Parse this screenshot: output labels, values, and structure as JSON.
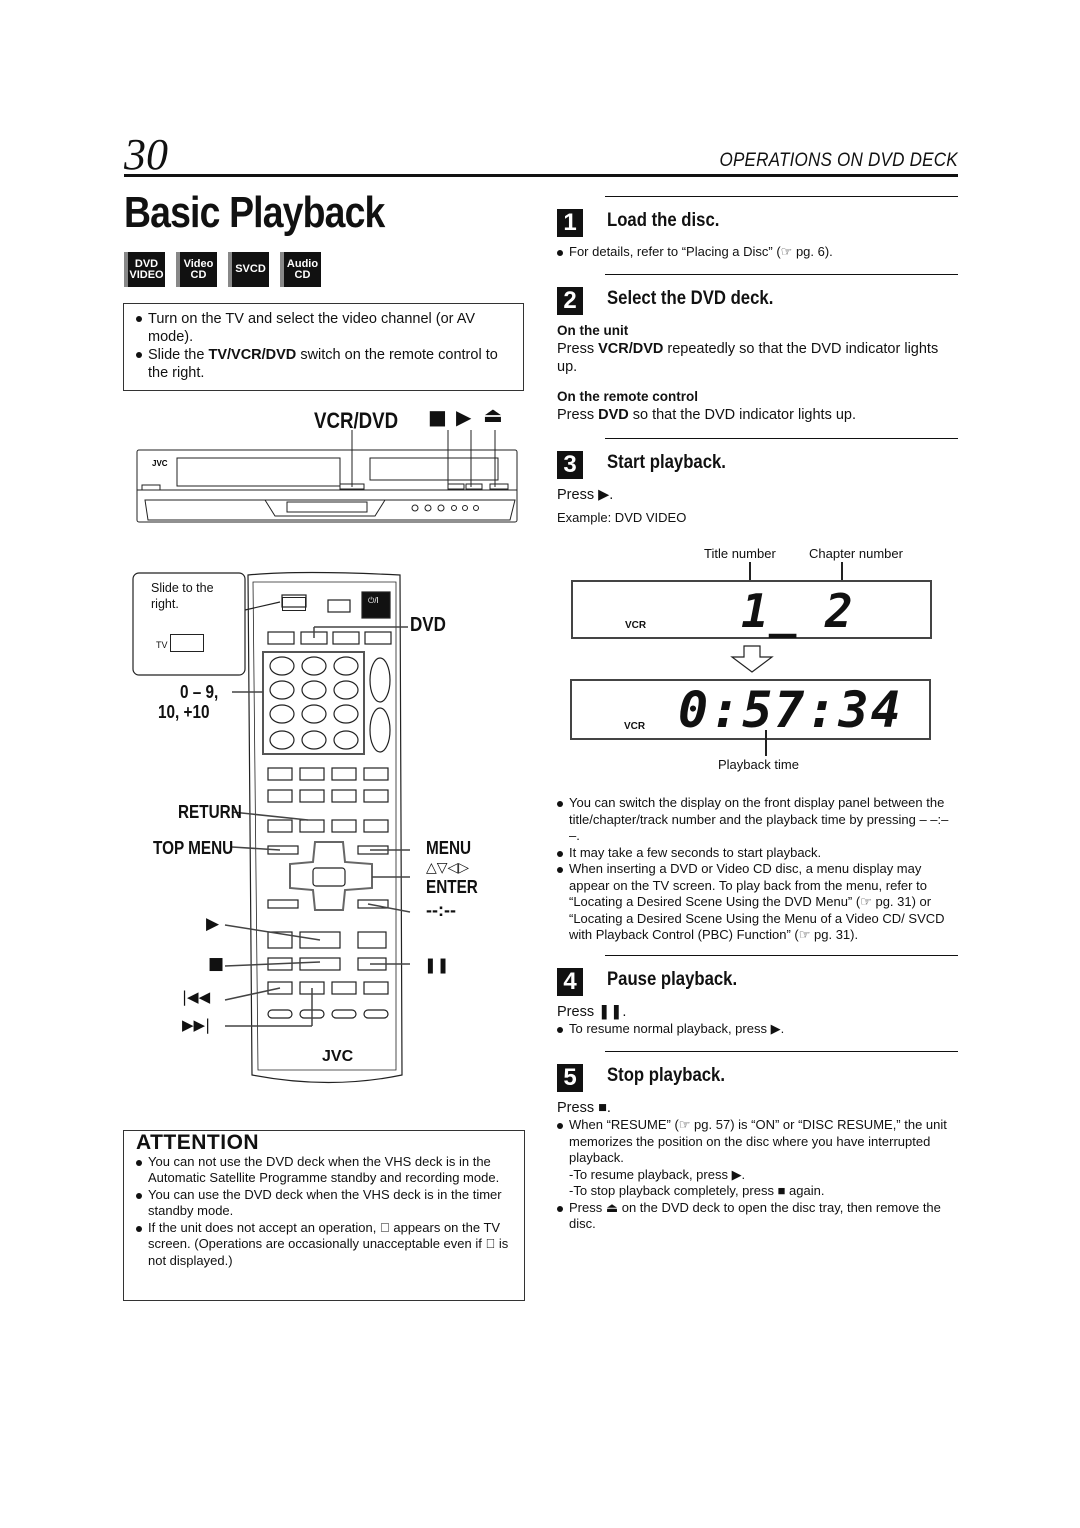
{
  "header": {
    "page_number": "30",
    "section_title": "OPERATIONS ON DVD DECK"
  },
  "title": "Basic Playback",
  "disc_badges": [
    {
      "line1": "DVD",
      "line2": "VIDEO"
    },
    {
      "line1": "Video",
      "line2": "CD"
    },
    {
      "line1": "SVCD",
      "line2": ""
    },
    {
      "line1": "Audio",
      "line2": "CD"
    }
  ],
  "prerequisites": [
    {
      "text": "Turn on the TV and select the video channel (or AV mode)."
    },
    {
      "pre": "Slide the ",
      "bold": "TV/VCR/DVD",
      "post": " switch on the remote control to the right."
    }
  ],
  "deck_diagram": {
    "vcr_dvd_label": "VCR/DVD",
    "stop_symbol": "■",
    "play_symbol": "▶",
    "eject_symbol": "⏏",
    "brand": "JVC"
  },
  "remote_diagram": {
    "slide_note": "Slide to the right.",
    "tv_label": "TV",
    "brand": "JVC",
    "power_label": "⏻/I",
    "labels": {
      "dvd": "DVD",
      "numbers_1": "0 – 9,",
      "numbers_2": "10, +10",
      "return": "RETURN",
      "top_menu": "TOP MENU",
      "menu": "MENU",
      "arrows": "△▽◁▷",
      "enter": "ENTER",
      "display": "--:--",
      "play": "▶",
      "stop": "■",
      "pause": "❚❚",
      "prev": "|◀◀",
      "next": "▶▶|"
    }
  },
  "attention": {
    "heading": "ATTENTION",
    "items": [
      "You can not use the DVD deck when the VHS deck is in the Automatic Satellite Programme standby and recording mode.",
      "You can use the DVD deck when the VHS deck is in the timer standby mode.",
      "If the unit does not accept an operation, ⃠ appears on the TV screen. (Operations are occasionally unacceptable even if ⃠ is not displayed.)"
    ]
  },
  "steps": [
    {
      "number": "1",
      "heading": "Load the disc.",
      "bullets": [
        "For details, refer to “Placing a Disc” (☞ pg. 6)."
      ]
    },
    {
      "number": "2",
      "heading": "Select the DVD deck.",
      "subsections": [
        {
          "label": "On the unit",
          "pre": "Press ",
          "bold": "VCR/DVD",
          "post": " repeatedly so that the DVD indicator lights up."
        },
        {
          "label": "On the remote control",
          "pre": "Press ",
          "bold": "DVD",
          "post": " so that the DVD indicator lights up."
        }
      ]
    },
    {
      "number": "3",
      "heading": "Start playback.",
      "press": "Press ▶.",
      "example": "Example: DVD VIDEO",
      "display": {
        "title_number_label": "Title number",
        "chapter_number_label": "Chapter number",
        "title_value": "1_",
        "chapter_value": "2",
        "indicator": "VCR",
        "time_value": "0:57:34",
        "playback_time_label": "Playback time"
      },
      "bullets": [
        "You can switch the display on the front display panel between the title/chapter/track number and the playback time by pressing – –:– –.",
        "It may take a few seconds to start playback.",
        "When inserting a DVD or Video CD disc, a menu display may appear on the TV screen. To play back from the menu, refer to “Locating a Desired Scene Using the DVD Menu” (☞ pg. 31) or “Locating a Desired Scene Using the Menu of a Video CD/ SVCD with Playback Control (PBC) Function” (☞ pg. 31)."
      ]
    },
    {
      "number": "4",
      "heading": "Pause playback.",
      "press": "Press ❚❚.",
      "bullets": [
        "To resume normal playback, press ▶."
      ]
    },
    {
      "number": "5",
      "heading": "Stop playback.",
      "press": "Press ■.",
      "bullets": [
        "When “RESUME” (☞ pg. 57) is “ON” or “DISC RESUME,” the unit memorizes the position on the disc where you have interrupted playback.",
        "Press ⏏ on the DVD deck to open the disc tray, then remove the disc."
      ],
      "sub_lines": [
        "-To resume playback, press ▶.",
        "-To stop playback completely, press ■ again."
      ]
    }
  ]
}
